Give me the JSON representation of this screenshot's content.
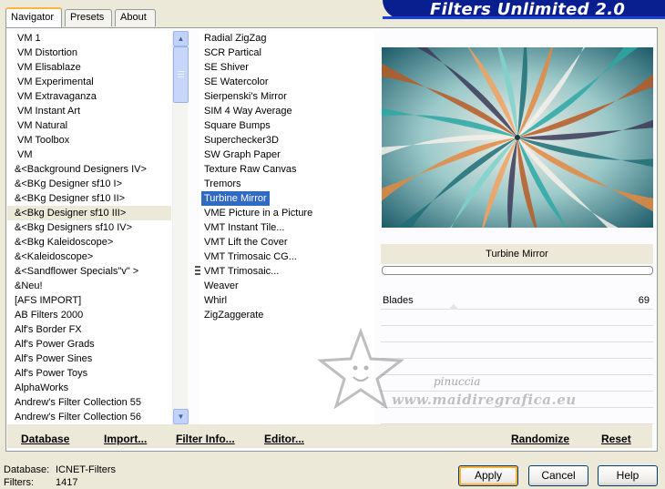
{
  "tabs": [
    {
      "label": "Navigator",
      "active": true
    },
    {
      "label": "Presets",
      "active": false
    },
    {
      "label": "About",
      "active": false
    }
  ],
  "app_title": "Filters Unlimited 2.0",
  "categories": [
    "VM 1",
    "VM Distortion",
    "VM Elisablaze",
    "VM Experimental",
    "VM Extravaganza",
    "VM Instant Art",
    "VM Natural",
    "VM Toolbox",
    "VM",
    "&<Background Designers IV>",
    "&<BKg Designer sf10 I>",
    "&<BKg Designer sf10 II>",
    "&<Bkg Designer sf10 III>",
    "&<Bkg Designers sf10 IV>",
    "&<Bkg Kaleidoscope>",
    "&<Kaleidoscope>",
    "&<Sandflower Specials\"v\" >",
    "&Neu!",
    "[AFS IMPORT]",
    "AB Filters 2000",
    "Alf's Border FX",
    "Alf's Power Grads",
    "Alf's Power Sines",
    "Alf's Power Toys",
    "AlphaWorks",
    "Andrew's Filter Collection 55",
    "Andrew's Filter Collection 56"
  ],
  "selected_category": "&<Bkg Designer sf10 III>",
  "filters": [
    "Radial ZigZag",
    "SCR  Partical",
    "SE Shiver",
    "SE Watercolor",
    "Sierpenski's Mirror",
    "SIM 4 Way Average",
    "Square Bumps",
    "Superchecker3D",
    "SW Graph Paper",
    "Texture Raw Canvas",
    "Tremors",
    "Turbine Mirror",
    "VME Picture in a Picture",
    "VMT Instant Tile...",
    "VMT Lift the Cover",
    "VMT Trimosaic CG...",
    "VMT Trimosaic...",
    "Weaver",
    "Whirl",
    "ZigZaggerate"
  ],
  "selected_filter": "Turbine Mirror",
  "filter_name": "Turbine Mirror",
  "params": [
    {
      "label": "Blades",
      "value": "69"
    }
  ],
  "toolbar": {
    "database": "Database",
    "import": "Import...",
    "filter_info": "Filter Info...",
    "editor": "Editor...",
    "randomize": "Randomize",
    "reset": "Reset"
  },
  "status": {
    "database_label": "Database:",
    "database_value": "ICNET-Filters",
    "filters_label": "Filters:",
    "filters_value": "1417"
  },
  "buttons": {
    "apply": "Apply",
    "cancel": "Cancel",
    "help": "Help"
  },
  "watermark": {
    "name": "pinuccia",
    "site": "www.maidiregrafica.eu"
  },
  "colors": {
    "selection": "#316ac5",
    "banner": "#0a1f8f",
    "preview_teal": "#2fa7a4",
    "preview_orange": "#e07a35"
  }
}
